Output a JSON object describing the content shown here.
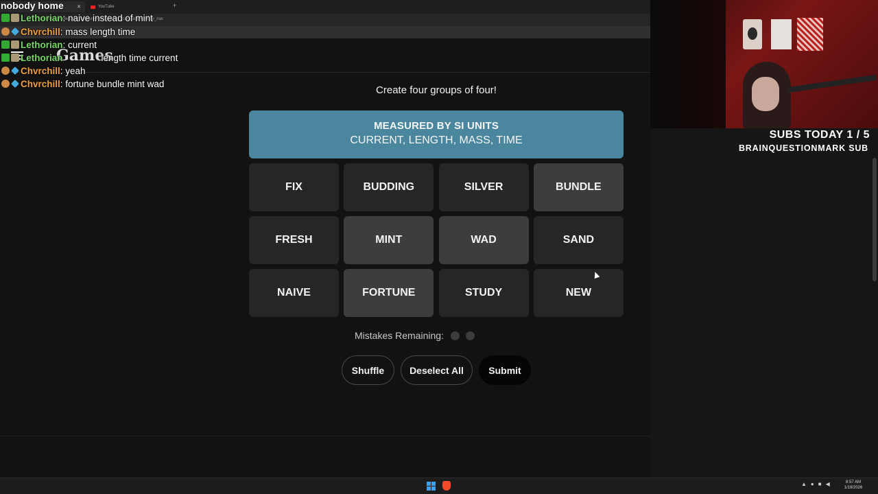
{
  "browser": {
    "tabs": [
      {
        "label": "",
        "active": true
      },
      {
        "label": "YouTube",
        "active": false
      }
    ],
    "url_fragment": "source=wordle&utm_medium=referral&utm_campaign=wordle_nav"
  },
  "site": {
    "logo": "Games"
  },
  "game": {
    "instructions": "Create four groups of four!",
    "solved_group": {
      "title": "MEASURED BY SI UNITS",
      "members": "CURRENT, LENGTH, MASS, TIME",
      "color": "#4a869e"
    },
    "tiles": [
      {
        "word": "FIX",
        "selected": false
      },
      {
        "word": "BUDDING",
        "selected": false
      },
      {
        "word": "SILVER",
        "selected": false
      },
      {
        "word": "BUNDLE",
        "selected": true
      },
      {
        "word": "FRESH",
        "selected": false
      },
      {
        "word": "MINT",
        "selected": true
      },
      {
        "word": "WAD",
        "selected": true
      },
      {
        "word": "SAND",
        "selected": false
      },
      {
        "word": "NAIVE",
        "selected": false
      },
      {
        "word": "FORTUNE",
        "selected": true
      },
      {
        "word": "STUDY",
        "selected": false
      },
      {
        "word": "NEW",
        "selected": false
      }
    ],
    "mistakes_label": "Mistakes Remaining:",
    "mistakes_remaining": 2,
    "buttons": {
      "shuffle": "Shuffle",
      "deselect": "Deselect All",
      "submit": "Submit"
    }
  },
  "chat": {
    "title": "nobody home",
    "messages": [
      {
        "user": "Lethorian",
        "text": ": naive instead of mint",
        "color": "#7bd66a"
      },
      {
        "user": "Chvrchill",
        "text": ": mass length time",
        "color": "#f0a040"
      },
      {
        "user": "Lethorian",
        "text": ": current",
        "color": "#7bd66a"
      },
      {
        "user": "Lethorian",
        "text": "length time current",
        "color": "#7bd66a"
      },
      {
        "user": "Chvrchill",
        "text": ": yeah",
        "color": "#f0a040"
      },
      {
        "user": "Chvrchill",
        "text": ": fortune bundle mint wad",
        "color": "#f0a040"
      }
    ]
  },
  "stream": {
    "subs_today": "SUBS TODAY 1 / 5",
    "latest_sub": "BRAINQUESTIONMARK SUB"
  },
  "taskbar": {
    "time": "8:57 AM",
    "date": "1/19/2026"
  }
}
